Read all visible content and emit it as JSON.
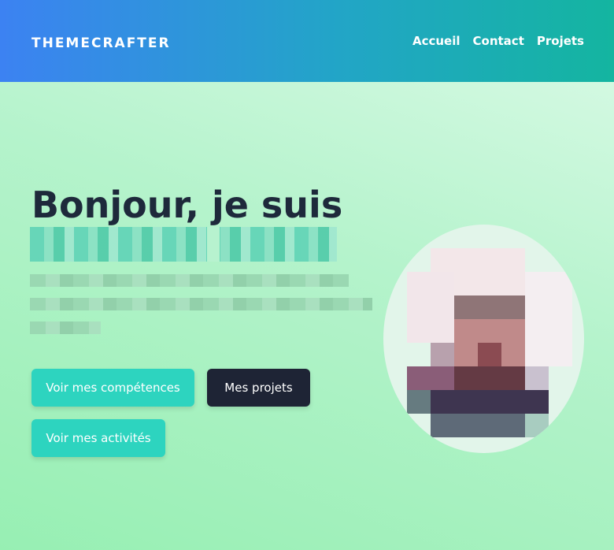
{
  "header": {
    "brand": "THEMECRAFTER",
    "nav": [
      "Accueil",
      "Contact",
      "Projets"
    ]
  },
  "hero": {
    "title": "Bonjour, je suis",
    "buttons": {
      "skills": "Voir mes compétences",
      "projects": "Mes projets",
      "activities": "Voir mes activités"
    }
  },
  "colors": {
    "accent": "#2dd4bf",
    "dark": "#1e2435",
    "header_start": "#3c82f2",
    "header_end": "#14b5a0"
  },
  "icons": {
    "avatar": "profile-photo-pixelated"
  }
}
